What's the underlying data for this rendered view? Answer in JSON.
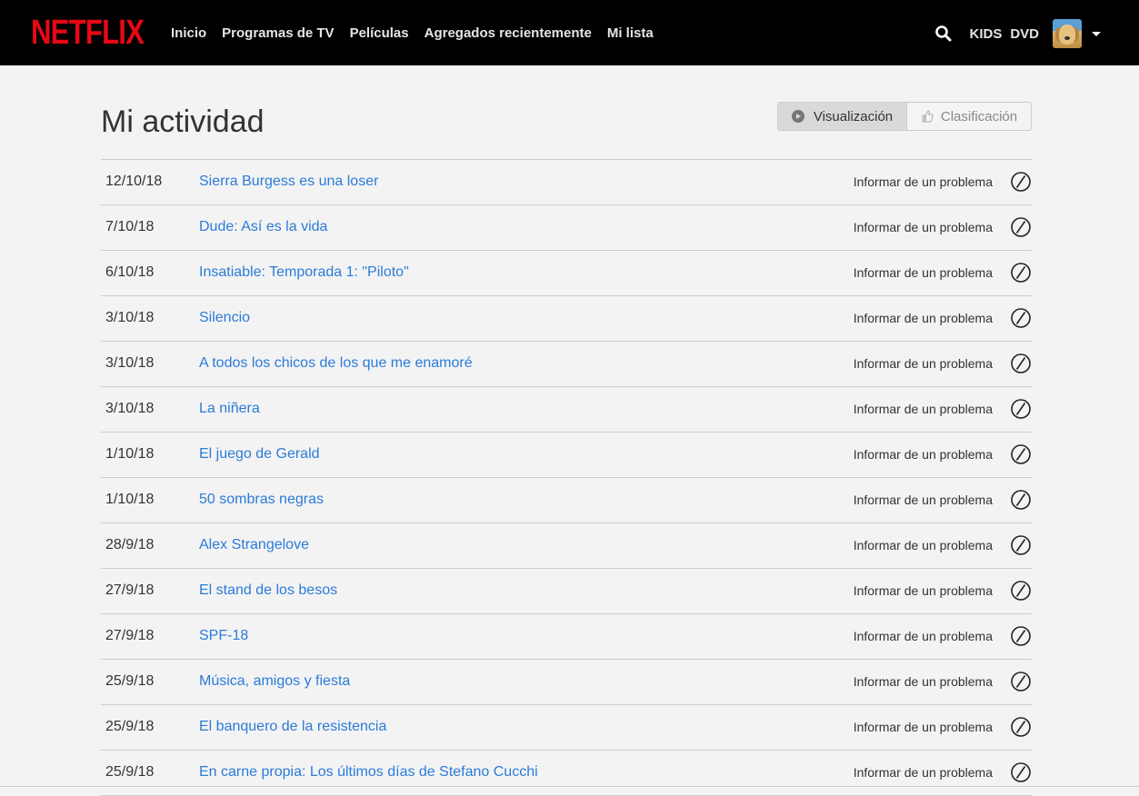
{
  "brand": {
    "logo_text": "NETFLIX",
    "logo_color": "#e50914"
  },
  "nav": {
    "items": [
      "Inicio",
      "Programas de TV",
      "Películas",
      "Agregados recientemente",
      "Mi lista"
    ],
    "search_icon": "search-icon",
    "kids_label": "KIDS",
    "dvd_label": "DVD",
    "profile_icon": "dog-avatar",
    "menu_icon": "caret-down-icon"
  },
  "page": {
    "title": "Mi actividad",
    "toggle": {
      "active_label": "Visualización",
      "inactive_label": "Clasificación",
      "active_icon": "play-icon",
      "inactive_icon": "thumbs-up-icon"
    }
  },
  "activity": {
    "report_label": "Informar de un problema",
    "hide_icon": "hide-from-history-icon",
    "link_color": "#2b7bd9",
    "rows": [
      {
        "date": "12/10/18",
        "title": "Sierra Burgess es una loser"
      },
      {
        "date": "7/10/18",
        "title": "Dude: Así es la vida"
      },
      {
        "date": "6/10/18",
        "title": "Insatiable: Temporada 1: \"Piloto\""
      },
      {
        "date": "3/10/18",
        "title": "Silencio"
      },
      {
        "date": "3/10/18",
        "title": "A todos los chicos de los que me enamoré"
      },
      {
        "date": "3/10/18",
        "title": "La niñera"
      },
      {
        "date": "1/10/18",
        "title": "El juego de Gerald"
      },
      {
        "date": "1/10/18",
        "title": "50 sombras negras"
      },
      {
        "date": "28/9/18",
        "title": "Alex Strangelove"
      },
      {
        "date": "27/9/18",
        "title": "El stand de los besos"
      },
      {
        "date": "27/9/18",
        "title": "SPF-18"
      },
      {
        "date": "25/9/18",
        "title": "Música, amigos y fiesta"
      },
      {
        "date": "25/9/18",
        "title": "El banquero de la resistencia"
      },
      {
        "date": "25/9/18",
        "title": "En carne propia: Los últimos días de Stefano Cucchi"
      }
    ]
  }
}
